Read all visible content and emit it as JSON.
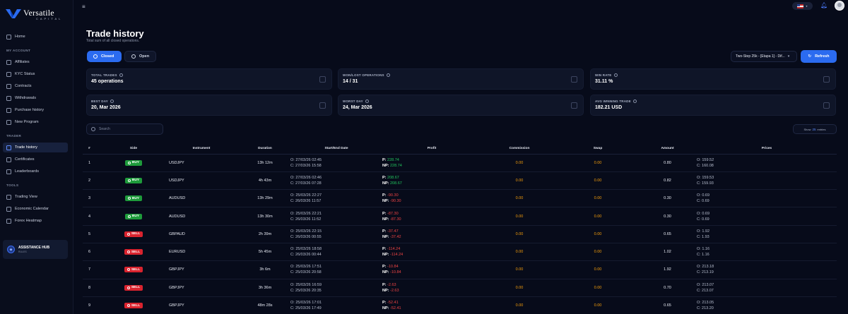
{
  "brand": {
    "name": "Versatile",
    "sub": "CAPITAL"
  },
  "sidebar": {
    "home": "Home",
    "sections": {
      "account": "MY ACCOUNT",
      "trader": "TRADER",
      "tools": "TOOLS"
    },
    "account_items": [
      "Affiliates",
      "KYC Status",
      "Contracts",
      "Withdrawals",
      "Purchase history",
      "New Program"
    ],
    "trader_items": [
      "Trade history",
      "Certificates",
      "Leaderboards"
    ],
    "tools_items": [
      "Trading View",
      "Economic Calendar",
      "Forex Heatmap"
    ],
    "assist": {
      "title": "ASSISTANCE HUB",
      "sub": "RULES"
    }
  },
  "header": {
    "title": "Trade history",
    "subtitle": "Total sum of all closed operations.",
    "tabs": {
      "closed": "Closed",
      "open": "Open"
    },
    "account": "Two-Step 25k - [Etapa 1] - Dif...",
    "refresh": "Refresh"
  },
  "stats": [
    {
      "label": "TOTAL TRADES",
      "value": "45 operations"
    },
    {
      "label": "WON/LOST OPERATIONS",
      "value": "14 / 31"
    },
    {
      "label": "WIN RATE",
      "value": "31.11 %"
    },
    {
      "label": "BEST DAY",
      "value": "20, Mar 2026"
    },
    {
      "label": "WORST DAY",
      "value": "24, Mar 2026"
    },
    {
      "label": "AVG WINNING TRADE",
      "value": "182.21 USD"
    }
  ],
  "search": {
    "placeholder": "Search"
  },
  "entries": {
    "show": "Show",
    "count": "25",
    "suffix": "entries"
  },
  "table": {
    "headers": [
      "#",
      "Side",
      "Instrument",
      "Duration",
      "Start/End Date",
      "Profit",
      "Commission",
      "Swap",
      "Amount",
      "Prices"
    ],
    "rows": [
      {
        "n": "1",
        "side": "BUY",
        "inst": "USDJPY",
        "dur": "13h 12m",
        "o": "O: 27/03/26 02:45",
        "c": "C: 27/03/26 15:58",
        "p": "228.74",
        "np": "228.74",
        "comm": "0.00",
        "swap": "0.00",
        "amt": "0.80",
        "po": "O: 159.52",
        "pc": "C: 160.08"
      },
      {
        "n": "2",
        "side": "BUY",
        "inst": "USDJPY",
        "dur": "4h 43m",
        "o": "O: 27/03/26 02:46",
        "c": "C: 27/03/26 07:28",
        "p": "208.67",
        "np": "208.67",
        "comm": "0.00",
        "swap": "0.00",
        "amt": "0.82",
        "po": "O: 159.53",
        "pc": "C: 159.93"
      },
      {
        "n": "3",
        "side": "BUY",
        "inst": "AUDUSD",
        "dur": "13h 29m",
        "o": "O: 25/03/26 22:27",
        "c": "C: 26/03/26 11:57",
        "p": "-90.30",
        "np": "-90.30",
        "comm": "0.00",
        "swap": "0.00",
        "amt": "0.30",
        "po": "O: 0.69",
        "pc": "C: 0.69"
      },
      {
        "n": "4",
        "side": "BUY",
        "inst": "AUDUSD",
        "dur": "13h 30m",
        "o": "O: 25/03/26 22:21",
        "c": "C: 26/03/26 11:52",
        "p": "-87.30",
        "np": "-87.30",
        "comm": "0.00",
        "swap": "0.00",
        "amt": "0.30",
        "po": "O: 0.69",
        "pc": "C: 0.69"
      },
      {
        "n": "5",
        "side": "SELL",
        "inst": "GBPAUD",
        "dur": "2h 39m",
        "o": "O: 25/03/26 22:15",
        "c": "C: 26/03/26 00:55",
        "p": "-37.47",
        "np": "-37.42",
        "comm": "0.00",
        "swap": "0.00",
        "amt": "0.65",
        "po": "O: 1.92",
        "pc": "C: 1.93"
      },
      {
        "n": "6",
        "side": "SELL",
        "inst": "EURUSD",
        "dur": "5h 45m",
        "o": "O: 25/03/26 18:58",
        "c": "C: 26/03/26 00:44",
        "p": "-114.24",
        "np": "-114.24",
        "comm": "0.00",
        "swap": "0.00",
        "amt": "1.02",
        "po": "O: 1.16",
        "pc": "C: 1.16"
      },
      {
        "n": "7",
        "side": "SELL",
        "inst": "GBPJPY",
        "dur": "3h 6m",
        "o": "O: 25/03/26 17:51",
        "c": "C: 25/03/26 20:58",
        "p": "-10.84",
        "np": "-10.84",
        "comm": "0.00",
        "swap": "0.00",
        "amt": "1.92",
        "po": "O: 213.18",
        "pc": "C: 213.19"
      },
      {
        "n": "8",
        "side": "SELL",
        "inst": "GBPJPY",
        "dur": "3h 36m",
        "o": "O: 25/03/26 16:59",
        "c": "C: 25/03/26 20:35",
        "p": "-2.63",
        "np": "-2.63",
        "comm": "0.00",
        "swap": "0.00",
        "amt": "0.70",
        "po": "O: 213.07",
        "pc": "C: 213.07"
      },
      {
        "n": "9",
        "side": "SELL",
        "inst": "GBPJPY",
        "dur": "48m 28s",
        "o": "O: 25/03/26 17:01",
        "c": "C: 25/03/26 17:49",
        "p": "-52.41",
        "np": "-52.41",
        "comm": "0.00",
        "swap": "0.00",
        "amt": "0.65",
        "po": "O: 213.05",
        "pc": "C: 213.20"
      }
    ]
  },
  "colors": {
    "accent": "#2b6bf0",
    "buy": "#1e9b3b",
    "sell": "#d9232e",
    "positive": "#22c55e",
    "negative": "#ef4444",
    "fee": "#f59e0b"
  }
}
